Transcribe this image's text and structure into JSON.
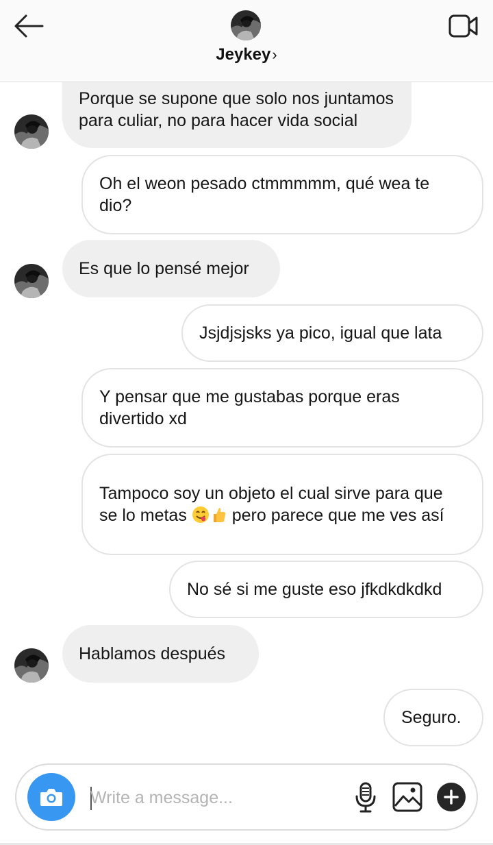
{
  "header": {
    "contact_name": "Jeykey",
    "chevron": "›",
    "back_icon": "arrow-left-icon",
    "video_icon": "video-camera-icon"
  },
  "messages": [
    {
      "direction": "incoming",
      "text": "Porque se supone que solo nos juntamos para culiar, no para hacer vida social"
    },
    {
      "direction": "outgoing",
      "text": "Oh el weon pesado ctmmmmm, qué wea te dio?"
    },
    {
      "direction": "incoming",
      "text": "Es que lo pensé mejor"
    },
    {
      "direction": "outgoing",
      "text": "Jsjdjsjsks ya pico, igual que lata"
    },
    {
      "direction": "outgoing",
      "text": "Y pensar que me gustabas porque eras divertido xd"
    },
    {
      "direction": "outgoing",
      "text_before": "Tampoco soy un objeto el cual sirve para que se lo metas ",
      "emojis": [
        "face-savoring-food-emoji",
        "thumbs-up-emoji"
      ],
      "text_after": " pero parece que me ves así"
    },
    {
      "direction": "outgoing",
      "text": "No sé si me guste eso jfkdkdkdkd"
    },
    {
      "direction": "incoming",
      "text": "Hablamos después"
    },
    {
      "direction": "outgoing",
      "text": "Seguro."
    }
  ],
  "composer": {
    "placeholder": "Write a message...",
    "value": "",
    "camera_icon": "camera-icon",
    "mic_icon": "microphone-icon",
    "gallery_icon": "image-gallery-icon",
    "plus_icon": "plus-icon"
  },
  "colors": {
    "accent_blue": "#3897f0",
    "incoming_bubble": "#efefef",
    "outgoing_border": "#e3e3e3"
  }
}
